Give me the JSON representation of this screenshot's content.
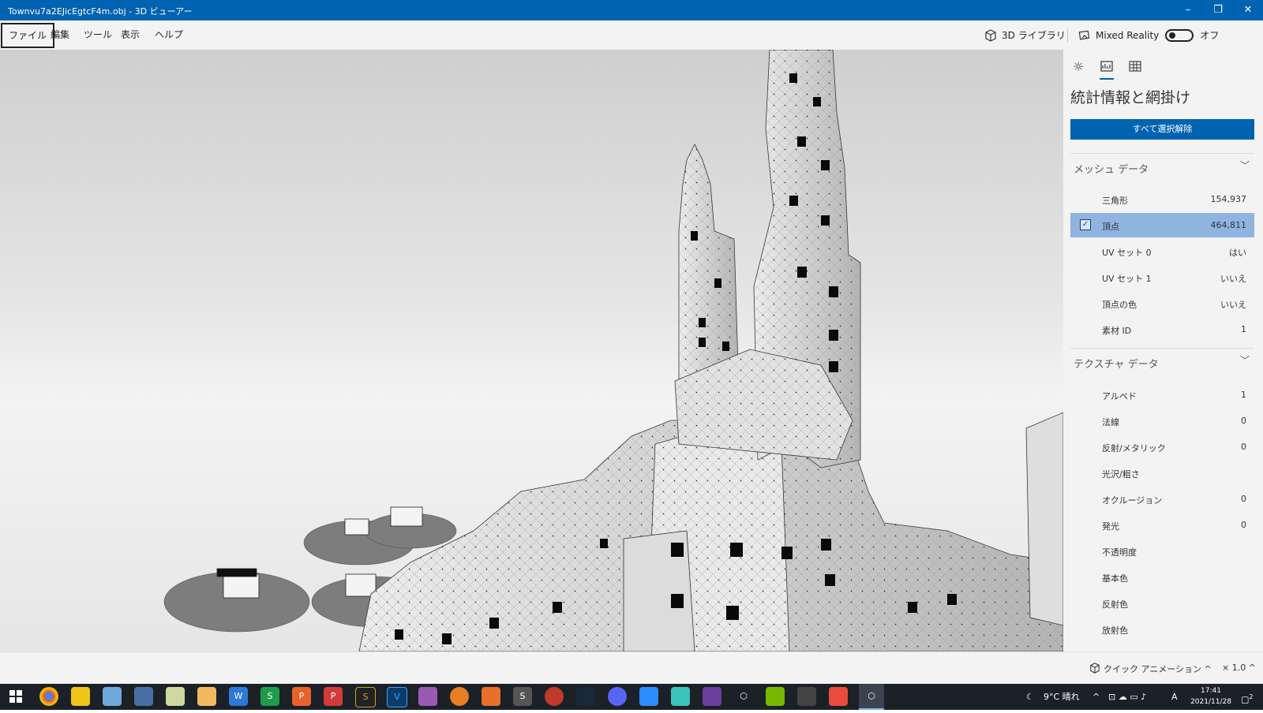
{
  "window": {
    "title": "Townvu7a2EJicEgtcF4m.obj - 3D ビューアー",
    "minimize": "–",
    "restore": "❐",
    "close": "✕"
  },
  "menu": {
    "items": [
      "ファイル",
      "編集",
      "ツール",
      "表示",
      "ヘルプ"
    ]
  },
  "toolbar": {
    "library_label": "3D ライブラリ",
    "mr_label": "Mixed Reality",
    "mr_state": "オフ"
  },
  "panel": {
    "title": "統計情報と網掛け",
    "deselect_button": "すべて選択解除",
    "mesh_section": {
      "title": "メッシュ データ",
      "rows": [
        {
          "label": "三角形",
          "value": "154,937"
        },
        {
          "label": "頂点",
          "value": "464,811",
          "selected": true
        },
        {
          "label": "UV セット 0",
          "value": "はい"
        },
        {
          "label": "UV セット 1",
          "value": "いいえ"
        },
        {
          "label": "頂点の色",
          "value": "いいえ"
        },
        {
          "label": "素材 ID",
          "value": "1"
        }
      ]
    },
    "texture_section": {
      "title": "テクスチャ データ",
      "rows": [
        {
          "label": "アルベド",
          "value": "1"
        },
        {
          "label": "法線",
          "value": "0"
        },
        {
          "label": "反射/メタリック",
          "value": "0"
        },
        {
          "label": "光沢/粗さ",
          "value": ""
        },
        {
          "label": "オクルージョン",
          "value": "0"
        },
        {
          "label": "発光",
          "value": "0"
        },
        {
          "label": "不透明度",
          "value": ""
        },
        {
          "label": "基本色",
          "value": ""
        },
        {
          "label": "反射色",
          "value": ""
        },
        {
          "label": "放射色",
          "value": ""
        }
      ]
    }
  },
  "status": {
    "quick_animation": "クイック アニメーション ^",
    "zoom": "× 1.0 ^"
  },
  "taskbar": {
    "weather": "9°C 晴れ",
    "ime": "A",
    "time": "17:41",
    "date": "2021/11/28",
    "notification_count": "2"
  }
}
